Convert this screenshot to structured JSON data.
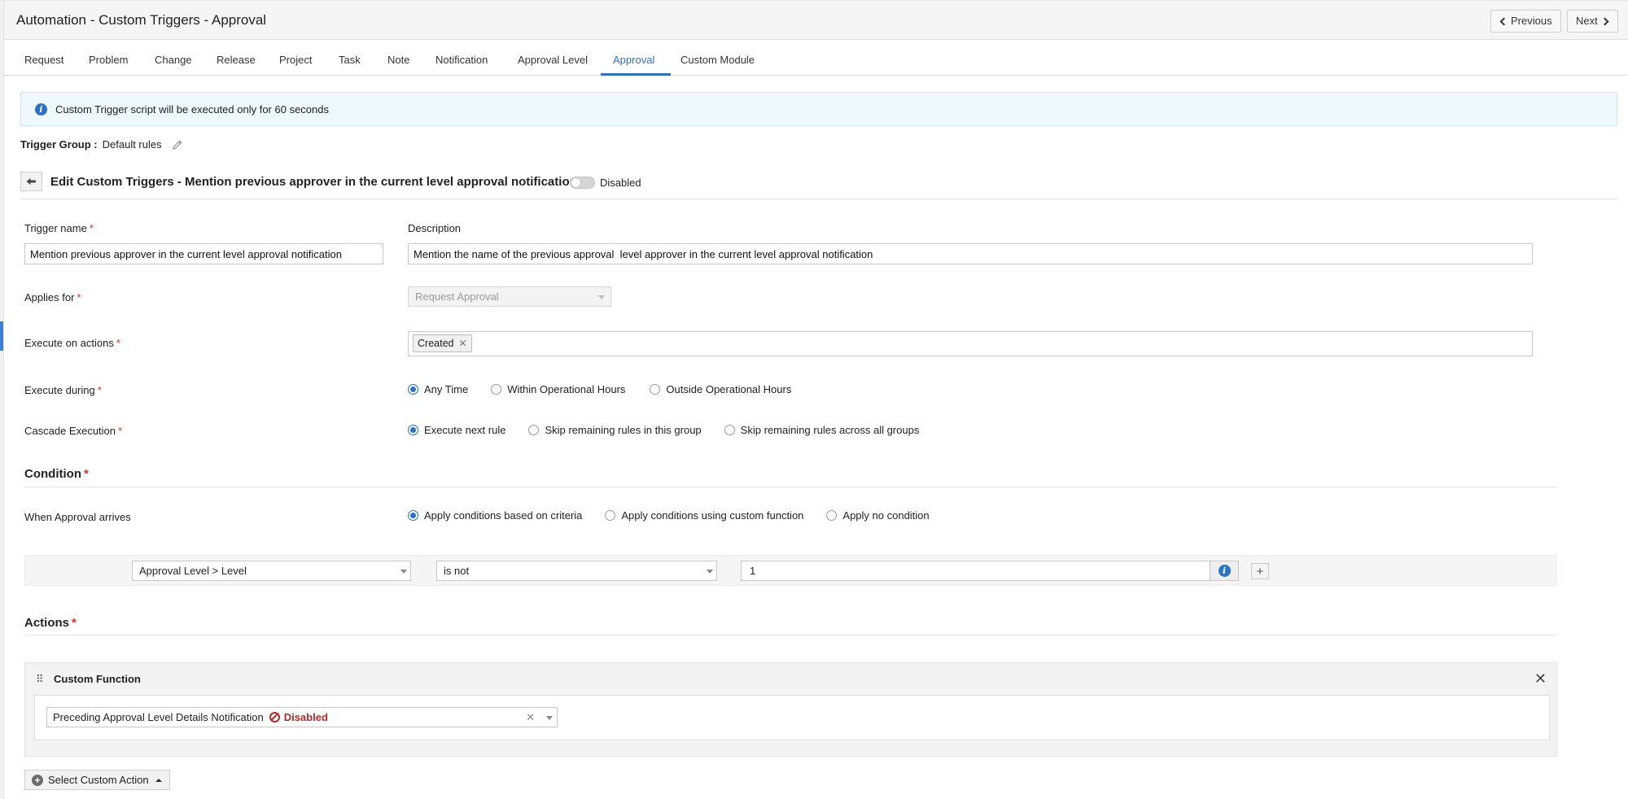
{
  "header": {
    "title": "Automation - Custom Triggers - Approval",
    "prev_label": "Previous",
    "next_label": "Next"
  },
  "tabs": [
    {
      "label": "Request"
    },
    {
      "label": "Problem"
    },
    {
      "label": "Change"
    },
    {
      "label": "Release"
    },
    {
      "label": "Project"
    },
    {
      "label": "Task"
    },
    {
      "label": "Note"
    },
    {
      "label": "Notification"
    },
    {
      "label": "Approval Level"
    },
    {
      "label": "Approval",
      "active": true
    },
    {
      "label": "Custom Module"
    }
  ],
  "info_banner": {
    "icon": "info-icon",
    "text": "Custom Trigger script will be executed only for 60 seconds"
  },
  "trigger_group": {
    "label": "Trigger Group :",
    "value": "Default rules",
    "edit_icon": "pencil-icon"
  },
  "edit": {
    "title": "Edit Custom Triggers - Mention previous approver in the current level approval notification",
    "status_label": "Disabled",
    "enabled": false
  },
  "form": {
    "trigger_name_label": "Trigger name",
    "trigger_name_value": "Mention previous approver in the current level approval notification",
    "description_label": "Description",
    "description_value": "Mention the name of the previous approval  level approver in the current level approval notification",
    "applies_for_label": "Applies for",
    "applies_for_value": "Request Approval",
    "execute_on_actions_label": "Execute on actions",
    "execute_on_actions_chips": [
      "Created"
    ],
    "execute_during_label": "Execute during",
    "execute_during_options": [
      "Any Time",
      "Within Operational Hours",
      "Outside Operational Hours"
    ],
    "execute_during_selected": "Any Time",
    "cascade_label": "Cascade Execution",
    "cascade_options": [
      "Execute next rule",
      "Skip remaining rules in this group",
      "Skip remaining rules across all groups"
    ],
    "cascade_selected": "Execute next rule"
  },
  "condition": {
    "title": "Condition",
    "when_label": "When Approval arrives",
    "options": [
      "Apply conditions based on criteria",
      "Apply conditions using custom function",
      "Apply no condition"
    ],
    "selected": "Apply conditions based on criteria",
    "criteria": {
      "field": "Approval Level > Level",
      "operator": "is not",
      "value": "1"
    }
  },
  "actions": {
    "title": "Actions",
    "panel_title": "Custom Function",
    "function_name": "Preceding Approval Level Details Notification",
    "function_status": "Disabled",
    "select_action_label": "Select Custom Action"
  },
  "colors": {
    "accent": "#2a72c8",
    "required": "#d93025",
    "disabled_status": "#b32a2a",
    "banner_bg": "#eef8fd"
  }
}
